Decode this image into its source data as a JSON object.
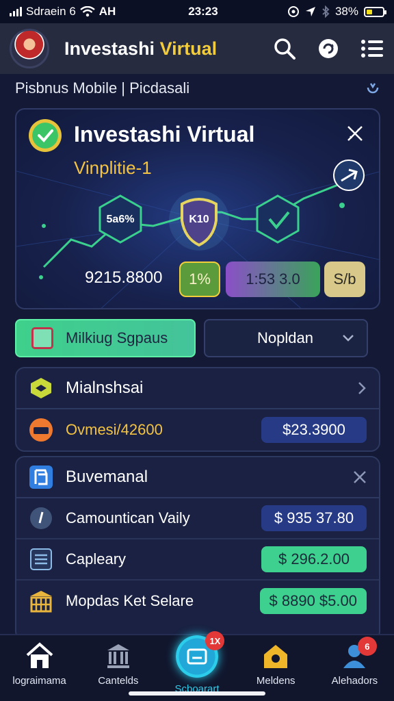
{
  "status_bar": {
    "carrier": "Sdraein 6",
    "network": "AH",
    "time": "23:23",
    "battery": "38%",
    "battery_level": 0.38
  },
  "header": {
    "title_part1": "Investashi",
    "title_part2": "Virtual"
  },
  "subheader": {
    "text": "Pisbnus Mobile | Picdasali"
  },
  "hero": {
    "title": "Investashi Virtual",
    "subtitle": "Vinplitie-1",
    "hex_left": "5a6%",
    "shield": "K10",
    "amount": "9215.8800",
    "pill_1": "1%",
    "pill_2": "1:53 3.0",
    "pill_3": "S/b"
  },
  "actions": {
    "primary_button": "Milkiug Sgpaus",
    "dropdown_value": "Nopldan"
  },
  "card_1": {
    "title": "Mialnshsai",
    "row_label": "Ovmesi/42600",
    "row_amount": "$23.3900"
  },
  "card_2": {
    "title": "Buvemanal",
    "rows": [
      {
        "label": "Camountican Vaily",
        "amount": "$ 935 37.80"
      },
      {
        "label": "Capleary",
        "amount": "$ 296.2.00"
      },
      {
        "label": "Mopdas Ket Selare",
        "amount": "$ 8890 $5.00"
      }
    ]
  },
  "bottom_nav": {
    "items": [
      {
        "label": "lograimama"
      },
      {
        "label": "Cantelds"
      },
      {
        "label": "Scboarart",
        "badge": "1X"
      },
      {
        "label": "Meldens"
      },
      {
        "label": "Alehadors",
        "badge": "6"
      }
    ]
  },
  "colors": {
    "accent": "#2bcdea",
    "gold": "#f2cc3b",
    "green": "#3dd08e",
    "navy": "#263a86",
    "background": "#141a35"
  }
}
